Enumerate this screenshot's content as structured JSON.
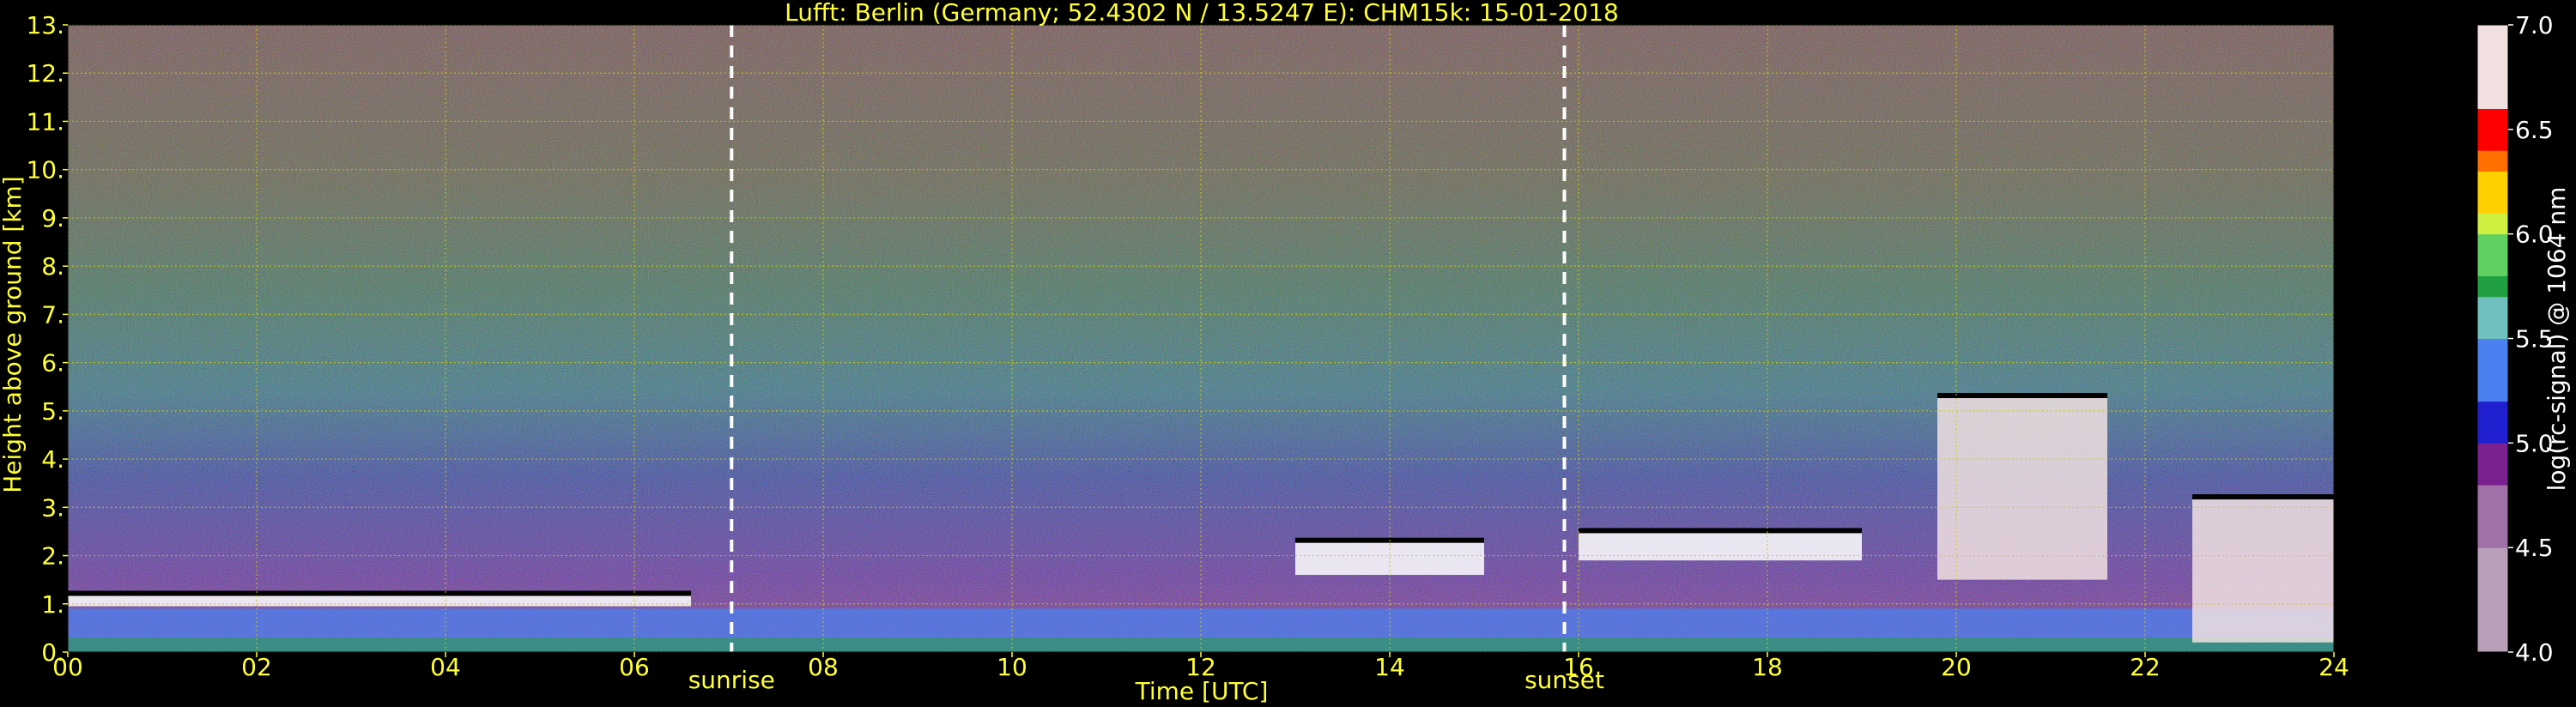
{
  "chart_data": {
    "type": "heatmap",
    "title": "Lufft: Berlin (Germany; 52.4302 N / 13.5247 E):    CHM15k: 15-01-2018",
    "xlabel": "Time [UTC]",
    "ylabel": "Height above ground [km]",
    "xlim": [
      0,
      24
    ],
    "ylim": [
      0,
      13
    ],
    "x_ticks": [
      "00",
      "02",
      "04",
      "06",
      "08",
      "10",
      "12",
      "14",
      "16",
      "18",
      "20",
      "22",
      "24"
    ],
    "y_ticks": [
      "0.",
      "1.",
      "2.",
      "3.",
      "4.",
      "5.",
      "6.",
      "7.",
      "8.",
      "9.",
      "10.",
      "11.",
      "12.",
      "13."
    ],
    "grid": true,
    "colorbar": {
      "label": "log(rc-signal) @ 1064 nm",
      "range": [
        4.0,
        7.0
      ],
      "ticks": [
        "4.0",
        "4.5",
        "5.0",
        "5.5",
        "6.0",
        "6.5",
        "7.0"
      ]
    },
    "annotations": [
      {
        "label": "sunrise",
        "x": 7.03
      },
      {
        "label": "sunset",
        "x": 15.85
      }
    ],
    "cloud_layers": [
      {
        "x_start": 0.0,
        "x_end": 6.6,
        "base_km": 0.95,
        "top_km": 1.2,
        "log_signal": 7.0
      },
      {
        "x_start": 13.0,
        "x_end": 15.0,
        "base_km": 1.6,
        "top_km": 2.3,
        "log_signal": 7.0
      },
      {
        "x_start": 16.0,
        "x_end": 19.0,
        "base_km": 1.9,
        "top_km": 2.5,
        "log_signal": 7.0
      },
      {
        "x_start": 19.8,
        "x_end": 21.6,
        "base_km": 1.5,
        "top_km": 5.3,
        "log_signal": 6.6
      },
      {
        "x_start": 22.5,
        "x_end": 24.0,
        "base_km": 0.2,
        "top_km": 3.2,
        "log_signal": 6.6
      }
    ],
    "boundary_layer": [
      {
        "x_start": 0.0,
        "x_end": 24.0,
        "top_km": 0.9,
        "log_signal": 5.4
      }
    ],
    "colors": {
      "axis_text": "#ffff33",
      "grid": "#cccc00",
      "colorbar_label": "#ffffff"
    }
  }
}
